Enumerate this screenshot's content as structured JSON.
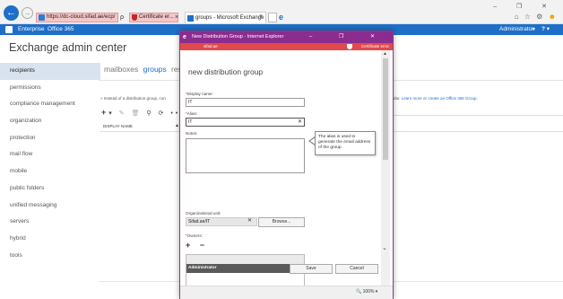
{
  "browser": {
    "address": "https://dc-cloud.sifad.ae/ecp/",
    "address_tools": "ρ ▾",
    "cert_label": "Certificate er...",
    "tab_title": "groups - Microsoft Exchange",
    "close": "×",
    "ie_glyph": "e",
    "window_controls": "– ❐ ✕",
    "fav_icons": "⌂ ☆ ⚙",
    "smile": "☻"
  },
  "o365": {
    "brand1": "Enterprise",
    "brand2": "Office 365",
    "user": "Administrator",
    "user_caret": "▼",
    "help": "? ▾"
  },
  "eac": {
    "title": "Exchange admin center",
    "nav": [
      "recipients",
      "permissions",
      "compliance management",
      "organization",
      "protection",
      "mail flow",
      "mobile",
      "public folders",
      "unified messaging",
      "servers",
      "hybrid",
      "tools"
    ],
    "subtabs": {
      "mailboxes": "mailboxes",
      "groups": "groups",
      "resources": "res"
    },
    "info_left": "» Instead of a distribution group, con",
    "info_right_prefix": "endar.",
    "info_link1": "Learn more",
    "info_mid": " or ",
    "info_link2": "create an Office 365 Group",
    "info_end": ".",
    "toolbar": {
      "add": "+",
      "dropdown": "▾",
      "edit": "✎",
      "delete": "🗑",
      "search": "⚲",
      "refresh": "⟳",
      "more": "•••"
    },
    "column": "DISPLAY NAME",
    "column_caret": "▲"
  },
  "popup": {
    "window_title": "New Distribution Group - Internet Explorer",
    "ie_glyph": "e",
    "controls": "– ❐ ✕",
    "url": "sifad.ae",
    "cert_error": "Certificate error",
    "heading": "new distribution group",
    "display_name_label": "*Display name:",
    "display_name_value": "IT",
    "alias_label": "*Alias:",
    "alias_value": "IT",
    "clear_x": "✕",
    "notes_label": "Notes:",
    "ou_label": "Organizational unit:",
    "ou_value": "Sifad.ae/IT",
    "browse_label": "Browse...",
    "owners_label": "*Owners:",
    "owner_tools": "+ −",
    "owners": [
      "Administrator"
    ],
    "tooltip": "The alias is used to generate the email address of the group.",
    "save_label": "Save",
    "cancel_label": "Cancel",
    "zoom": "🔍 100%  ▾",
    "scroll_up": "▲",
    "scroll_down": "⌄"
  }
}
